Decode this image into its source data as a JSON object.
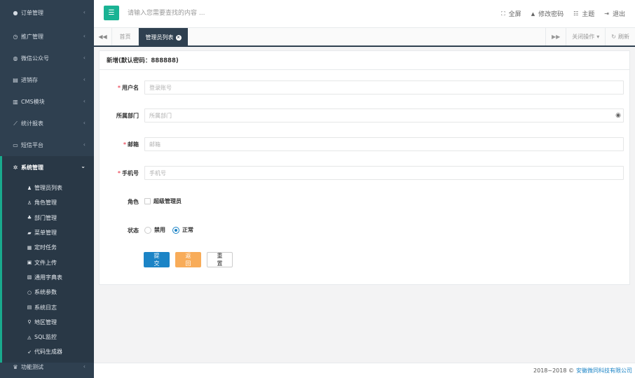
{
  "sidebar": {
    "items": [
      {
        "icon": "●",
        "icon_name": "asterisk-icon",
        "label": "订单管理"
      },
      {
        "icon": "◷",
        "icon_name": "clock-icon",
        "label": "推广管理"
      },
      {
        "icon": "◍",
        "icon_name": "wechat-icon",
        "label": "微信公众号"
      },
      {
        "icon": "▤",
        "icon_name": "inventory-icon",
        "label": "进销存"
      },
      {
        "icon": "▥",
        "icon_name": "cms-icon",
        "label": "CMS模块"
      },
      {
        "icon": "⟋",
        "icon_name": "line-chart-icon",
        "label": "统计报表"
      },
      {
        "icon": "▭",
        "icon_name": "monitor-icon",
        "label": "短信平台"
      }
    ],
    "active": {
      "icon": "✲",
      "icon_name": "gear-icon",
      "label": "系统管理"
    },
    "submenu": [
      {
        "icon": "♟",
        "icon_name": "user-icon",
        "label": "管理员列表"
      },
      {
        "icon": "♙",
        "icon_name": "role-icon",
        "label": "角色管理"
      },
      {
        "icon": "♣",
        "icon_name": "sitemap-icon",
        "label": "部门管理"
      },
      {
        "icon": "▰",
        "icon_name": "folder-icon",
        "label": "菜单管理"
      },
      {
        "icon": "▦",
        "icon_name": "task-icon",
        "label": "定时任务"
      },
      {
        "icon": "▣",
        "icon_name": "file-icon",
        "label": "文件上传"
      },
      {
        "icon": "▧",
        "icon_name": "book-icon",
        "label": "通用字典表"
      },
      {
        "icon": "○",
        "icon_name": "circle-icon",
        "label": "系统参数"
      },
      {
        "icon": "▤",
        "icon_name": "log-icon",
        "label": "系统日志"
      },
      {
        "icon": "⚲",
        "icon_name": "map-pin-icon",
        "label": "地区管理"
      },
      {
        "icon": "◬",
        "icon_name": "sql-icon",
        "label": "SQL监控"
      },
      {
        "icon": "➶",
        "icon_name": "send-icon",
        "label": "代码生成器"
      }
    ],
    "bottom": {
      "icon": "♛",
      "icon_name": "bank-icon",
      "label": "功能测试"
    }
  },
  "header": {
    "search_placeholder": "请输入您需要查找的内容 ...",
    "actions": [
      {
        "icon": "⛶",
        "icon_name": "fullscreen-icon",
        "label": "全屏"
      },
      {
        "icon": "🔒",
        "icon_name": "lock-icon",
        "label": "修改密码"
      },
      {
        "icon": "☷",
        "icon_name": "theme-icon",
        "label": "主题"
      },
      {
        "icon": "⇥",
        "icon_name": "logout-icon",
        "label": "退出"
      }
    ]
  },
  "tabs": {
    "home": "首页",
    "active": "管理员列表",
    "close_ops": "关闭操作",
    "refresh": "刷新"
  },
  "form": {
    "title": "新增(默认密码：888888)",
    "username": {
      "label": "用户名",
      "placeholder": "登录账号"
    },
    "department": {
      "label": "所属部门",
      "placeholder": "所属部门"
    },
    "email": {
      "label": "邮箱",
      "placeholder": "邮箱"
    },
    "phone": {
      "label": "手机号",
      "placeholder": "手机号"
    },
    "role": {
      "label": "角色",
      "option": "超级管理员"
    },
    "status": {
      "label": "状态",
      "options": [
        "禁用",
        "正常"
      ],
      "selected": "正常"
    },
    "buttons": {
      "submit": "提交",
      "back": "返回",
      "reset": "重置"
    }
  },
  "footer": {
    "copyright": "2018~2018 ©",
    "company": "安徽微同科技有限公司"
  }
}
